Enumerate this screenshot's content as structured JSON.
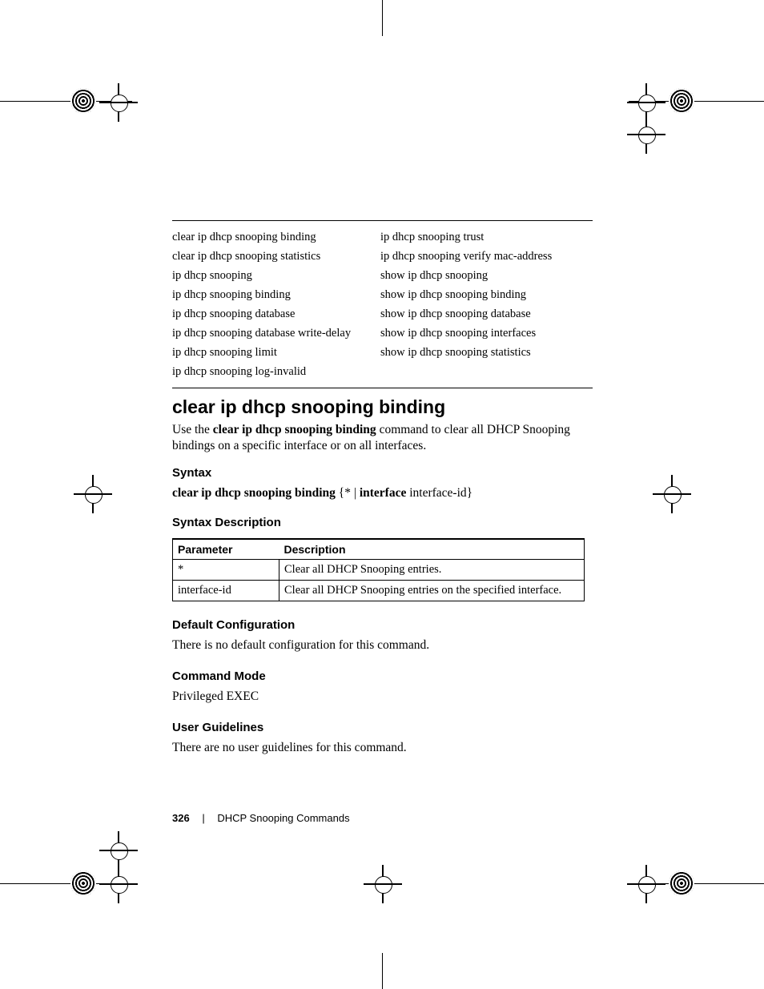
{
  "commands": {
    "left": [
      "clear ip dhcp snooping binding",
      "clear ip dhcp snooping statistics",
      "ip dhcp snooping",
      "ip dhcp snooping binding",
      "ip dhcp snooping database",
      "ip dhcp snooping database write-delay",
      "ip dhcp snooping limit",
      "ip dhcp snooping log-invalid"
    ],
    "right": [
      "ip dhcp snooping trust",
      "ip dhcp snooping verify mac-address",
      "show ip dhcp snooping",
      "show ip dhcp snooping binding",
      "show ip dhcp snooping database",
      "show ip dhcp snooping interfaces",
      "show ip dhcp snooping statistics",
      ""
    ]
  },
  "section": {
    "title": "clear ip dhcp snooping binding",
    "intro_pre": "Use the ",
    "intro_bold": "clear ip dhcp snooping binding",
    "intro_post": " command to clear all DHCP Snooping bindings on a specific interface or on all interfaces."
  },
  "syntax": {
    "heading": "Syntax",
    "line_bold1": "clear ip dhcp snooping binding",
    "line_mid1": " {*  | ",
    "line_bold2": "interface",
    "line_mid2": " interface-id}"
  },
  "syntax_desc": {
    "heading": "Syntax Description",
    "headers": {
      "param": "Parameter",
      "desc": "Description"
    },
    "rows": [
      {
        "param": "*",
        "desc": "Clear all DHCP Snooping entries."
      },
      {
        "param": "interface-id",
        "desc": "Clear all DHCP Snooping entries on the specified interface."
      }
    ]
  },
  "default_cfg": {
    "heading": "Default Configuration",
    "text": "There is no default configuration for this command."
  },
  "mode": {
    "heading": "Command Mode",
    "text": "Privileged EXEC"
  },
  "guidelines": {
    "heading": "User Guidelines",
    "text": "There are no user guidelines for this command."
  },
  "footer": {
    "page": "326",
    "chapter": "DHCP Snooping Commands"
  }
}
